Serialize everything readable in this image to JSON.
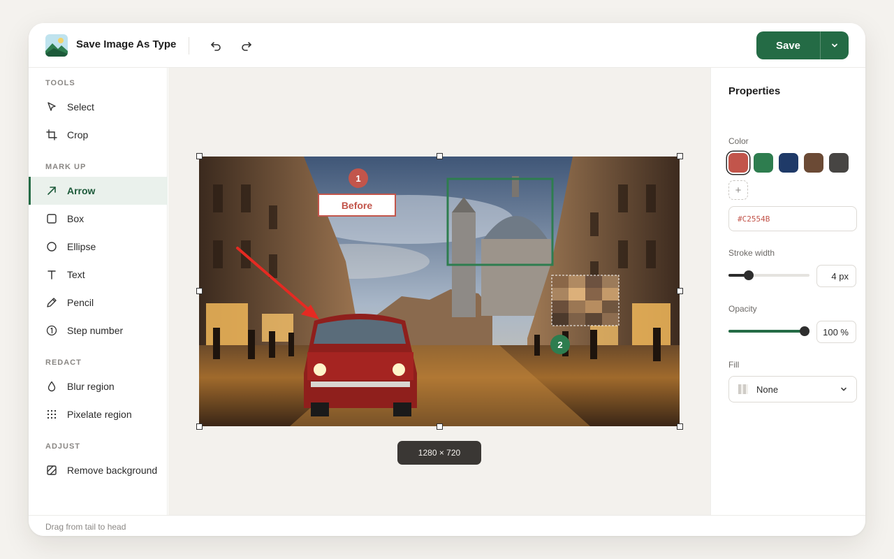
{
  "app": {
    "title": "Save Image As Type"
  },
  "header": {
    "undo_icon": "undo-icon",
    "redo_icon": "redo-icon",
    "save_label": "Save",
    "save_menu_icon": "chevron-down-icon",
    "accent_color": "#246B45"
  },
  "sidebar": {
    "sections": [
      {
        "label": "TOOLS",
        "items": [
          {
            "label": "Select",
            "icon": "cursor-icon"
          },
          {
            "label": "Crop",
            "icon": "crop-icon"
          }
        ]
      },
      {
        "label": "MARK UP",
        "items": [
          {
            "label": "Arrow",
            "icon": "arrow-icon",
            "active": true
          },
          {
            "label": "Box",
            "icon": "box-icon"
          },
          {
            "label": "Ellipse",
            "icon": "ellipse-icon"
          },
          {
            "label": "Text",
            "icon": "text-icon"
          },
          {
            "label": "Pencil",
            "icon": "pencil-icon"
          },
          {
            "label": "Step number",
            "icon": "step-number-icon"
          }
        ]
      },
      {
        "label": "REDACT",
        "items": [
          {
            "label": "Blur region",
            "icon": "droplet-icon"
          },
          {
            "label": "Pixelate region",
            "icon": "grid-dots-icon"
          }
        ]
      },
      {
        "label": "ADJUST",
        "items": [
          {
            "label": "Remove background",
            "icon": "remove-background-icon"
          }
        ]
      }
    ]
  },
  "canvas": {
    "image_size": "1280 × 720",
    "annotations": {
      "step_1": "1",
      "step_2": "2",
      "text_box": "Before"
    }
  },
  "properties": {
    "title": "Properties",
    "color_label": "Color",
    "swatches": [
      "#C2554B",
      "#2E7D4F",
      "#1F3A68",
      "#6B4A35",
      "#474543"
    ],
    "selected_swatch": "#C2554B",
    "hex_value": "#C2554B",
    "stroke_label": "Stroke width",
    "stroke_value": "4 px",
    "stroke_fraction": 0.22,
    "opacity_label": "Opacity",
    "opacity_value": "100 %",
    "opacity_fraction": 1.0,
    "fill_label": "Fill",
    "fill_value": "None"
  },
  "status": {
    "hint": "Drag from tail to head"
  }
}
